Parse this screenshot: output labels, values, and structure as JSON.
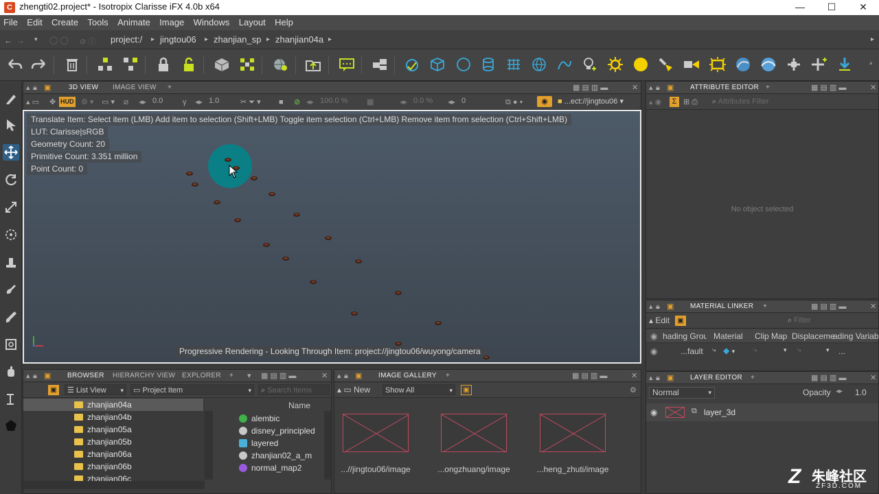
{
  "window": {
    "title": "zhengti02.project* - Isotropix Clarisse iFX 4.0b x64",
    "min": "—",
    "max": "☐",
    "close": "✕"
  },
  "menu": [
    "File",
    "Edit",
    "Create",
    "Tools",
    "Animate",
    "Image",
    "Windows",
    "Layout",
    "Help"
  ],
  "breadcrumb": [
    "project:/",
    "jingtou06",
    "zhanjian_sp",
    "zhanjian04a"
  ],
  "viewport_panel": {
    "tabs": [
      "3D VIEW",
      "IMAGE VIEW"
    ],
    "add": "+",
    "hud": "HUD",
    "field_a": "0.0",
    "field_b": "1.0",
    "zoom": "100.0 %",
    "pct": "0.0 %",
    "frame": "0",
    "path": "...ect://jingtou06",
    "overlay": [
      "Translate Item: Select item (LMB)  Add item to selection (Shift+LMB)  Toggle item selection (Ctrl+LMB)  Remove item from selection (Ctrl+Shift+LMB)",
      "LUT: Clarisse|sRGB",
      "Geometry Count: 20",
      "Primitive Count: 3.351 million",
      "Point Count: 0"
    ],
    "status": "Progressive Rendering - Looking Through Item: project://jingtou06/wuyong/camera"
  },
  "attribute_editor": {
    "title": "ATTRIBUTE EDITOR",
    "filter_placeholder": "Attributes Filter",
    "empty": "No object selected"
  },
  "material_linker": {
    "title": "MATERIAL LINKER",
    "edit": "Edit",
    "filter_placeholder": "Filter",
    "columns": [
      "hading Grou",
      "Material",
      "Clip Map",
      "Displacemen",
      "ading Variab"
    ],
    "row_value": "...fault",
    "row_end": "..."
  },
  "layer_editor": {
    "title": "LAYER EDITOR",
    "blend": "Normal",
    "opacity_label": "Opacity",
    "opacity": "1.0",
    "layer": "layer_3d"
  },
  "browser": {
    "tabs": [
      "BROWSER",
      "HIERARCHY VIEW",
      "EXPLORER"
    ],
    "view": "List View",
    "item_type": "Project Item",
    "search_placeholder": "Search Items",
    "name_header": "Name",
    "folders": [
      "zhanjian04a",
      "zhanjian04b",
      "zhanjian05a",
      "zhanjian05b",
      "zhanjian06a",
      "zhanjian06b",
      "zhanjian06c"
    ],
    "items": [
      {
        "name": "alembic",
        "color": "#3fb24a"
      },
      {
        "name": "disney_principled",
        "color": "#c8c8c8"
      },
      {
        "name": "layered",
        "color": "#4ab0d8"
      },
      {
        "name": "zhanjian02_a_m",
        "color": "#c8c8c8"
      },
      {
        "name": "normal_map2",
        "color": "#9a5ae0"
      }
    ]
  },
  "image_gallery": {
    "title": "IMAGE GALLERY",
    "new": "New",
    "show": "Show All",
    "captions": [
      "...//jingtou06/image",
      "...ongzhuang/image",
      "...heng_zhuti/image"
    ]
  },
  "watermark": {
    "text": "朱峰社区",
    "sub": "ZF3D.COM"
  },
  "colors": {
    "accent": "#f5d000",
    "cursor_circle": "#0b7f86",
    "panel": "#3e3e3e"
  }
}
